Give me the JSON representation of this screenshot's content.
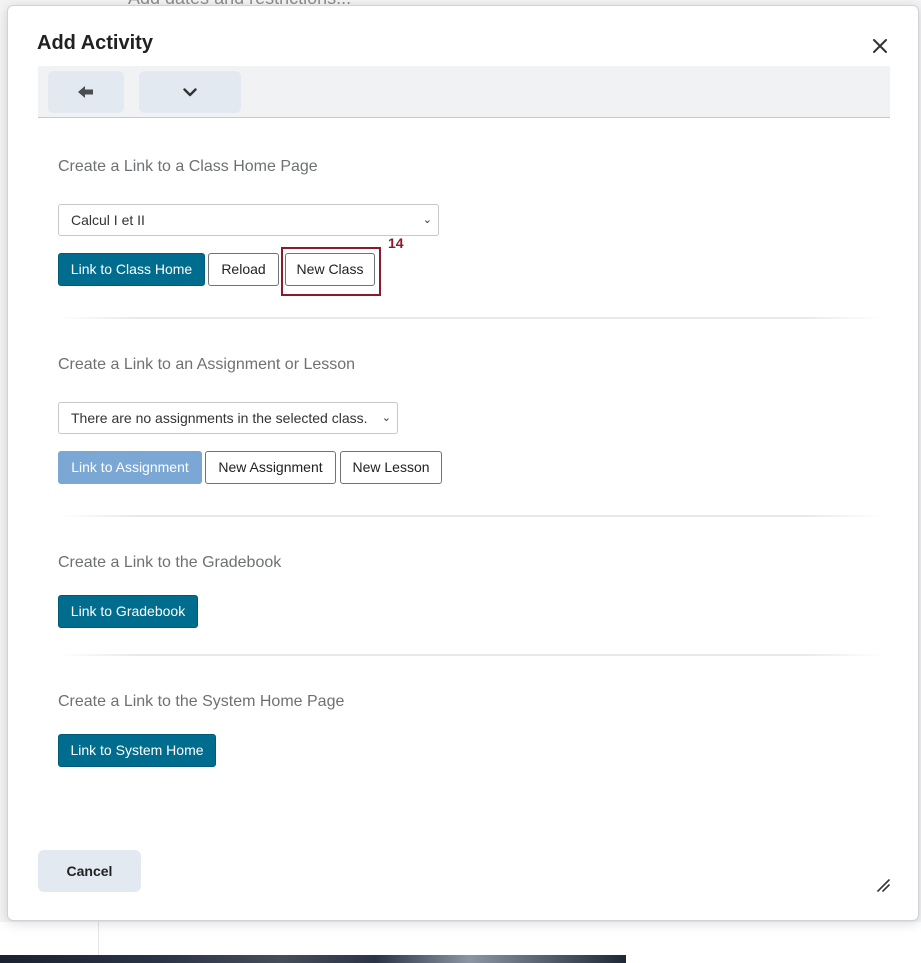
{
  "background": {
    "top_text": "Add dates and restrictions..."
  },
  "dialog": {
    "title": "Add Activity",
    "close_icon": "close-icon",
    "toolbar": {
      "back_icon": "arrow-left-icon",
      "more_icon": "chevron-down-icon"
    },
    "class_home": {
      "title": "Create a Link to a Class Home Page",
      "select_value": "Calcul I et II",
      "buttons": {
        "link": "Link to Class Home",
        "reload": "Reload",
        "new_class": "New Class"
      },
      "highlight_label": "14"
    },
    "assignment": {
      "title": "Create a Link to an Assignment or Lesson",
      "select_value": "There are no assignments in the selected class.",
      "buttons": {
        "link": "Link to Assignment",
        "new_assignment": "New Assignment",
        "new_lesson": "New Lesson"
      }
    },
    "gradebook": {
      "title": "Create a Link to the Gradebook",
      "button": "Link to Gradebook"
    },
    "system_home": {
      "title": "Create a Link to the System Home Page",
      "button": "Link to System Home"
    },
    "cancel_label": "Cancel",
    "resize_icon": "resize-handle-icon"
  },
  "colors": {
    "primary": "#006d8f",
    "disabled": "#7ba7d4",
    "highlight": "#8b1a2b",
    "secondary_bg": "#e3e9f1"
  }
}
